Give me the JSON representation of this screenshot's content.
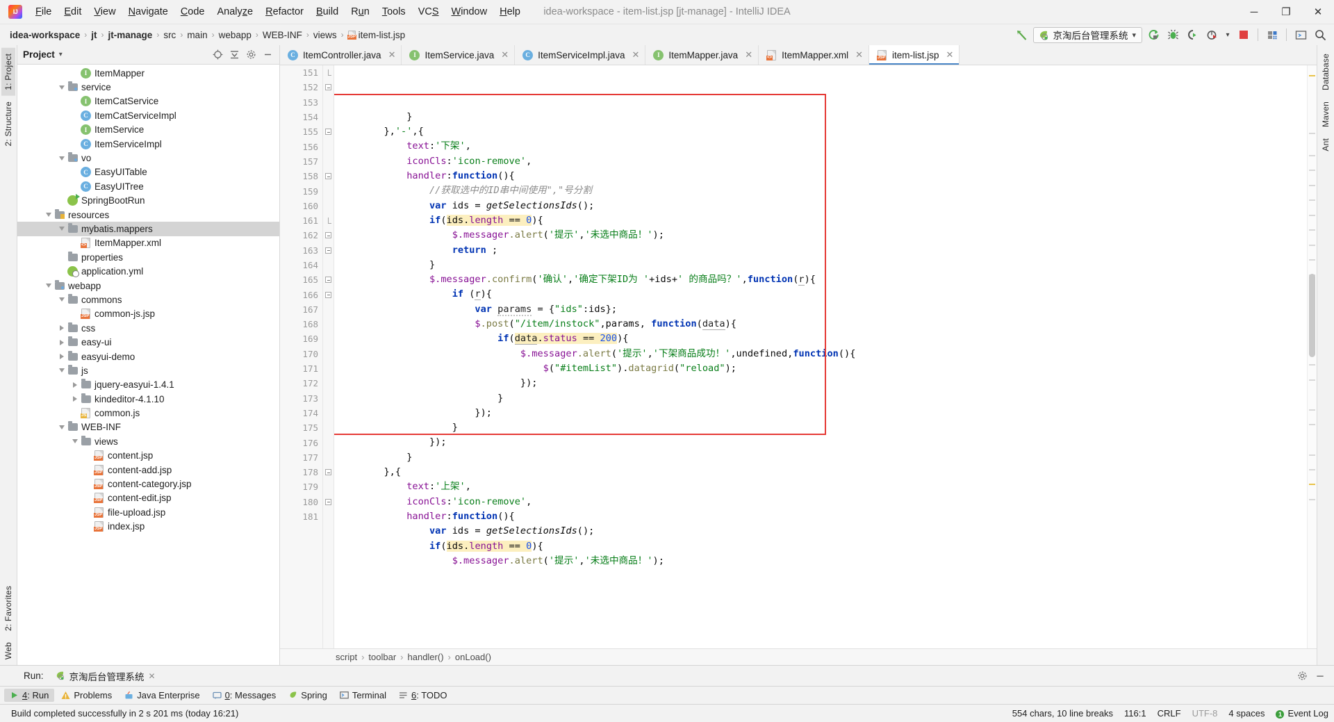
{
  "window": {
    "title": "idea-workspace - item-list.jsp [jt-manage] - IntelliJ IDEA",
    "minimize": "─",
    "maximize": "❐",
    "close": "✕"
  },
  "menubar": {
    "items": [
      {
        "label": "File",
        "mnemonic": "F"
      },
      {
        "label": "Edit",
        "mnemonic": "E"
      },
      {
        "label": "View",
        "mnemonic": "V"
      },
      {
        "label": "Navigate",
        "mnemonic": "N"
      },
      {
        "label": "Code",
        "mnemonic": "C"
      },
      {
        "label": "Analyze",
        "mnemonic": "z"
      },
      {
        "label": "Refactor",
        "mnemonic": "R"
      },
      {
        "label": "Build",
        "mnemonic": "B"
      },
      {
        "label": "Run",
        "mnemonic": "u"
      },
      {
        "label": "Tools",
        "mnemonic": "T"
      },
      {
        "label": "VCS",
        "mnemonic": "S"
      },
      {
        "label": "Window",
        "mnemonic": "W"
      },
      {
        "label": "Help",
        "mnemonic": "H"
      }
    ]
  },
  "breadcrumbs": {
    "items": [
      {
        "label": "idea-workspace",
        "bold": true
      },
      {
        "label": "jt",
        "bold": true
      },
      {
        "label": "jt-manage",
        "bold": true
      },
      {
        "label": "src",
        "bold": false
      },
      {
        "label": "main",
        "bold": false
      },
      {
        "label": "webapp",
        "bold": false
      },
      {
        "label": "WEB-INF",
        "bold": false
      },
      {
        "label": "views",
        "bold": false
      },
      {
        "label": "item-list.jsp",
        "bold": false,
        "icon": "jsp-file-icon"
      }
    ],
    "separator": "›"
  },
  "toolbar": {
    "run_config": "京淘后台管理系统",
    "dropdown_caret": "▾",
    "icons": [
      {
        "name": "run-icon",
        "glyph": "▶"
      },
      {
        "name": "debug-icon",
        "glyph": "🐞"
      },
      {
        "name": "run-with-coverage-icon",
        "glyph": "▶"
      },
      {
        "name": "profile-icon",
        "glyph": "◔"
      },
      {
        "name": "stop-icon",
        "glyph": "■"
      },
      {
        "name": "project-structure-icon",
        "glyph": "▦"
      },
      {
        "name": "terminal-icon",
        "glyph": "▣"
      },
      {
        "name": "search-everywhere-icon",
        "glyph": "⌕"
      }
    ]
  },
  "left_strip": {
    "top": [
      "1: Project",
      "2: Structure"
    ],
    "bottom": [
      "2: Favorites",
      "Web"
    ]
  },
  "right_strip": {
    "items": [
      "Database",
      "Maven",
      "Ant"
    ]
  },
  "project_panel": {
    "title": "Project",
    "caret": "▾",
    "tree": [
      {
        "indent": 4,
        "twisty": "none",
        "icon": "interface-icon",
        "label": "ItemMapper"
      },
      {
        "indent": 3,
        "twisty": "down",
        "icon": "folder-src-icon",
        "label": "service"
      },
      {
        "indent": 4,
        "twisty": "none",
        "icon": "interface-icon",
        "label": "ItemCatService"
      },
      {
        "indent": 4,
        "twisty": "none",
        "icon": "class-icon",
        "label": "ItemCatServiceImpl"
      },
      {
        "indent": 4,
        "twisty": "none",
        "icon": "interface-icon",
        "label": "ItemService"
      },
      {
        "indent": 4,
        "twisty": "none",
        "icon": "class-icon",
        "label": "ItemServiceImpl"
      },
      {
        "indent": 3,
        "twisty": "down",
        "icon": "folder-src-icon",
        "label": "vo"
      },
      {
        "indent": 4,
        "twisty": "none",
        "icon": "class-icon",
        "label": "EasyUITable"
      },
      {
        "indent": 4,
        "twisty": "none",
        "icon": "class-icon",
        "label": "EasyUITree"
      },
      {
        "indent": 3,
        "twisty": "none",
        "icon": "spring-run-icon",
        "label": "SpringBootRun"
      },
      {
        "indent": 2,
        "twisty": "down",
        "icon": "folder-res-icon",
        "label": "resources"
      },
      {
        "indent": 3,
        "twisty": "down",
        "icon": "folder-icon",
        "label": "mybatis.mappers",
        "selected": true
      },
      {
        "indent": 4,
        "twisty": "none",
        "icon": "xml-file-icon",
        "label": "ItemMapper.xml"
      },
      {
        "indent": 3,
        "twisty": "none",
        "icon": "folder-icon",
        "label": "properties"
      },
      {
        "indent": 3,
        "twisty": "none",
        "icon": "spring-icon",
        "label": "application.yml"
      },
      {
        "indent": 2,
        "twisty": "down",
        "icon": "folder-src-icon",
        "label": "webapp"
      },
      {
        "indent": 3,
        "twisty": "down",
        "icon": "folder-icon",
        "label": "commons"
      },
      {
        "indent": 4,
        "twisty": "none",
        "icon": "jsp-file-icon",
        "label": "common-js.jsp"
      },
      {
        "indent": 3,
        "twisty": "right",
        "icon": "folder-icon",
        "label": "css"
      },
      {
        "indent": 3,
        "twisty": "right",
        "icon": "folder-icon",
        "label": "easy-ui"
      },
      {
        "indent": 3,
        "twisty": "right",
        "icon": "folder-icon",
        "label": "easyui-demo"
      },
      {
        "indent": 3,
        "twisty": "down",
        "icon": "folder-icon",
        "label": "js"
      },
      {
        "indent": 4,
        "twisty": "right",
        "icon": "folder-icon",
        "label": "jquery-easyui-1.4.1"
      },
      {
        "indent": 4,
        "twisty": "right",
        "icon": "folder-icon",
        "label": "kindeditor-4.1.10"
      },
      {
        "indent": 4,
        "twisty": "none",
        "icon": "js-file-icon",
        "label": "common.js"
      },
      {
        "indent": 3,
        "twisty": "down",
        "icon": "folder-icon",
        "label": "WEB-INF"
      },
      {
        "indent": 4,
        "twisty": "down",
        "icon": "folder-icon",
        "label": "views"
      },
      {
        "indent": 5,
        "twisty": "none",
        "icon": "jsp-file-icon",
        "label": "content.jsp"
      },
      {
        "indent": 5,
        "twisty": "none",
        "icon": "jsp-file-icon",
        "label": "content-add.jsp"
      },
      {
        "indent": 5,
        "twisty": "none",
        "icon": "jsp-file-icon",
        "label": "content-category.jsp"
      },
      {
        "indent": 5,
        "twisty": "none",
        "icon": "jsp-file-icon",
        "label": "content-edit.jsp"
      },
      {
        "indent": 5,
        "twisty": "none",
        "icon": "jsp-file-icon",
        "label": "file-upload.jsp"
      },
      {
        "indent": 5,
        "twisty": "none",
        "icon": "jsp-file-icon",
        "label": "index.jsp"
      }
    ]
  },
  "editor_tabs": [
    {
      "label": "ItemController.java",
      "icon": "class-icon",
      "active": false
    },
    {
      "label": "ItemService.java",
      "icon": "interface-icon",
      "active": false
    },
    {
      "label": "ItemServiceImpl.java",
      "icon": "class-icon",
      "active": false
    },
    {
      "label": "ItemMapper.java",
      "icon": "interface-icon",
      "active": false
    },
    {
      "label": "ItemMapper.xml",
      "icon": "xml-file-icon",
      "active": false
    },
    {
      "label": "item-list.jsp",
      "icon": "jsp-file-icon",
      "active": true
    }
  ],
  "editor": {
    "first_line": 151,
    "lines": [
      {
        "n": 151,
        "fold": "end",
        "html": "            <span class=\"pln\">}</span>"
      },
      {
        "n": 152,
        "fold": "minus",
        "html": "        <span class=\"pln\">},</span><span class=\"str\">'-'</span><span class=\"pln\">,{</span>"
      },
      {
        "n": 153,
        "fold": "",
        "html": "            <span class=\"prop\">text</span><span class=\"pln\">:</span><span class=\"str\">'下架'</span><span class=\"pln\">,</span>"
      },
      {
        "n": 154,
        "fold": "",
        "html": "            <span class=\"prop\">iconCls</span><span class=\"pln\">:</span><span class=\"str\">'icon-remove'</span><span class=\"pln\">,</span>"
      },
      {
        "n": 155,
        "fold": "minus",
        "html": "            <span class=\"prop\">handler</span><span class=\"pln\">:</span><span class=\"kw\">function</span><span class=\"pln\">(){</span>"
      },
      {
        "n": 156,
        "fold": "",
        "html": "                <span class=\"com\">//获取选中的ID串中间使用\",\"号分割</span>"
      },
      {
        "n": 157,
        "fold": "",
        "html": "                <span class=\"kw\">var</span><span class=\"pln\"> ids = </span><span class=\"ital\">getSelectionsIds</span><span class=\"pln\">();</span>"
      },
      {
        "n": 158,
        "fold": "minus",
        "html": "                <span class=\"kw\">if</span><span class=\"pln\">(</span><span class=\"hl\"><span class=\"pln\">ids.</span><span class=\"prop\">length</span><span class=\"pln\"> == </span><span class=\"num\">0</span></span><span class=\"pln\">){</span>"
      },
      {
        "n": 159,
        "fold": "",
        "html": "                    <span class=\"prop\">$.messager</span><span class=\"fn\">.alert</span><span class=\"pln\">(</span><span class=\"str\">'提示'</span><span class=\"pln\">,</span><span class=\"str\">'未选中商品！'</span><span class=\"pln\">);</span>"
      },
      {
        "n": 160,
        "fold": "",
        "html": "                    <span class=\"kw\">return</span><span class=\"pln\"> ;</span>"
      },
      {
        "n": 161,
        "fold": "end",
        "html": "                <span class=\"pln\">}</span>"
      },
      {
        "n": 162,
        "fold": "minus",
        "html": "                <span class=\"prop\">$.messager</span><span class=\"fn\">.confirm</span><span class=\"pln\">(</span><span class=\"str\">'确认'</span><span class=\"pln\">,</span><span class=\"str\">'确定下架ID为 '</span><span class=\"pln\">+ids+</span><span class=\"str\">' 的商品吗？'</span><span class=\"pln\">,</span><span class=\"kw\">function</span><span class=\"pln\">(</span><span class=\"undl\">r</span><span class=\"pln\">){</span>"
      },
      {
        "n": 163,
        "fold": "minus",
        "html": "                    <span class=\"kw\">if</span><span class=\"pln\"> (</span><span class=\"undl\">r</span><span class=\"pln\">){</span>"
      },
      {
        "n": 164,
        "fold": "",
        "html": "                        <span class=\"kw\">var</span><span class=\"pln\"> </span><span class=\"wavy\">params</span><span class=\"pln\"> = {</span><span class=\"str\">\"ids\"</span><span class=\"pln\">:ids};</span>"
      },
      {
        "n": 165,
        "fold": "minus",
        "html": "                        <span class=\"prop\">$</span><span class=\"fn\">.post</span><span class=\"pln\">(</span><span class=\"str\">\"/item/instock\"</span><span class=\"pln\">,params, </span><span class=\"kw\">function</span><span class=\"pln\">(</span><span class=\"undl\">data</span><span class=\"pln\">){</span>"
      },
      {
        "n": 166,
        "fold": "minus",
        "html": "                            <span class=\"kw\">if</span><span class=\"pln\">(</span><span class=\"hl\"><span class=\"undl\">data</span><span class=\"pln\">.</span><span class=\"prop\">status</span><span class=\"pln\"> == </span><span class=\"num\">200</span></span><span class=\"pln\">){</span>"
      },
      {
        "n": 167,
        "fold": "",
        "html": "                                <span class=\"prop\">$.messager</span><span class=\"fn\">.alert</span><span class=\"pln\">(</span><span class=\"str\">'提示'</span><span class=\"pln\">,</span><span class=\"str\">'下架商品成功！'</span><span class=\"pln\">,undefined,</span><span class=\"kw\">function</span><span class=\"pln\">(){</span>"
      },
      {
        "n": 168,
        "fold": "",
        "html": "                                    <span class=\"prop\">$</span><span class=\"pln\">(</span><span class=\"str\">\"#itemList\"</span><span class=\"pln\">).</span><span class=\"fn\">datagrid</span><span class=\"pln\">(</span><span class=\"str\">\"reload\"</span><span class=\"pln\">);</span>"
      },
      {
        "n": 169,
        "fold": "",
        "html": "                                <span class=\"pln\">});</span>"
      },
      {
        "n": 170,
        "fold": "",
        "html": "                            <span class=\"pln\">}</span>"
      },
      {
        "n": 171,
        "fold": "",
        "html": "                        <span class=\"pln\">});</span>"
      },
      {
        "n": 172,
        "fold": "",
        "html": "                    <span class=\"pln\">}</span>"
      },
      {
        "n": 173,
        "fold": "",
        "html": "                <span class=\"pln\">});</span>"
      },
      {
        "n": 174,
        "fold": "",
        "html": "            <span class=\"pln\">}</span>"
      },
      {
        "n": 175,
        "fold": "",
        "html": "        <span class=\"pln\">},{</span>"
      },
      {
        "n": 176,
        "fold": "",
        "html": "            <span class=\"prop\">text</span><span class=\"pln\">:</span><span class=\"str\">'上架'</span><span class=\"pln\">,</span>"
      },
      {
        "n": 177,
        "fold": "",
        "html": "            <span class=\"prop\">iconCls</span><span class=\"pln\">:</span><span class=\"str\">'icon-remove'</span><span class=\"pln\">,</span>"
      },
      {
        "n": 178,
        "fold": "minus",
        "html": "            <span class=\"prop\">handler</span><span class=\"pln\">:</span><span class=\"kw\">function</span><span class=\"pln\">(){</span>"
      },
      {
        "n": 179,
        "fold": "",
        "html": "                <span class=\"kw\">var</span><span class=\"pln\"> ids = </span><span class=\"ital\">getSelectionsIds</span><span class=\"pln\">();</span>"
      },
      {
        "n": 180,
        "fold": "minus",
        "html": "                <span class=\"kw\">if</span><span class=\"pln\">(</span><span class=\"hl\"><span class=\"pln\">ids.</span><span class=\"prop\">length</span><span class=\"pln\"> == </span><span class=\"num\">0</span></span><span class=\"pln\">){</span>"
      },
      {
        "n": 181,
        "fold": "",
        "html": "                    <span class=\"prop\">$.messager</span><span class=\"fn\">.alert</span><span class=\"pln\">(</span><span class=\"str\">'提示'</span><span class=\"pln\">,</span><span class=\"str\">'未选中商品！'</span><span class=\"pln\">);</span>"
      }
    ],
    "highlight_box": {
      "color": "#e53935",
      "from_line": 153,
      "to_line": 175
    }
  },
  "editor_breadcrumb": {
    "items": [
      "script",
      "toolbar",
      "handler()",
      "onLoad()"
    ],
    "separator": "›"
  },
  "run_panel": {
    "label": "Run:",
    "config_name": "京淘后台管理系统",
    "close": "✕",
    "settings_icon": "gear-icon",
    "hide_icon": "─"
  },
  "bottom_tools": [
    {
      "label": "4: Run",
      "mnemonic": "4",
      "icon": "run-icon",
      "selected": true
    },
    {
      "label": "Problems",
      "icon": "warning-icon",
      "selected": false
    },
    {
      "label": "Java Enterprise",
      "icon": "java-icon",
      "selected": false
    },
    {
      "label": "0: Messages",
      "mnemonic": "0",
      "icon": "messages-icon",
      "selected": false
    },
    {
      "label": "Spring",
      "icon": "spring-icon",
      "selected": false
    },
    {
      "label": "Terminal",
      "icon": "terminal-icon",
      "selected": false
    },
    {
      "label": "6: TODO",
      "mnemonic": "6",
      "icon": "todo-icon",
      "selected": false
    }
  ],
  "statusbar": {
    "message": "Build completed successfully in 2 s 201 ms (today 16:21)",
    "chars": "554 chars, 10 line breaks",
    "caret": "116:1",
    "line_sep": "CRLF",
    "encoding": "UTF-8",
    "indent": "4 spaces",
    "event_log": "Event Log",
    "event_badge": "1"
  }
}
